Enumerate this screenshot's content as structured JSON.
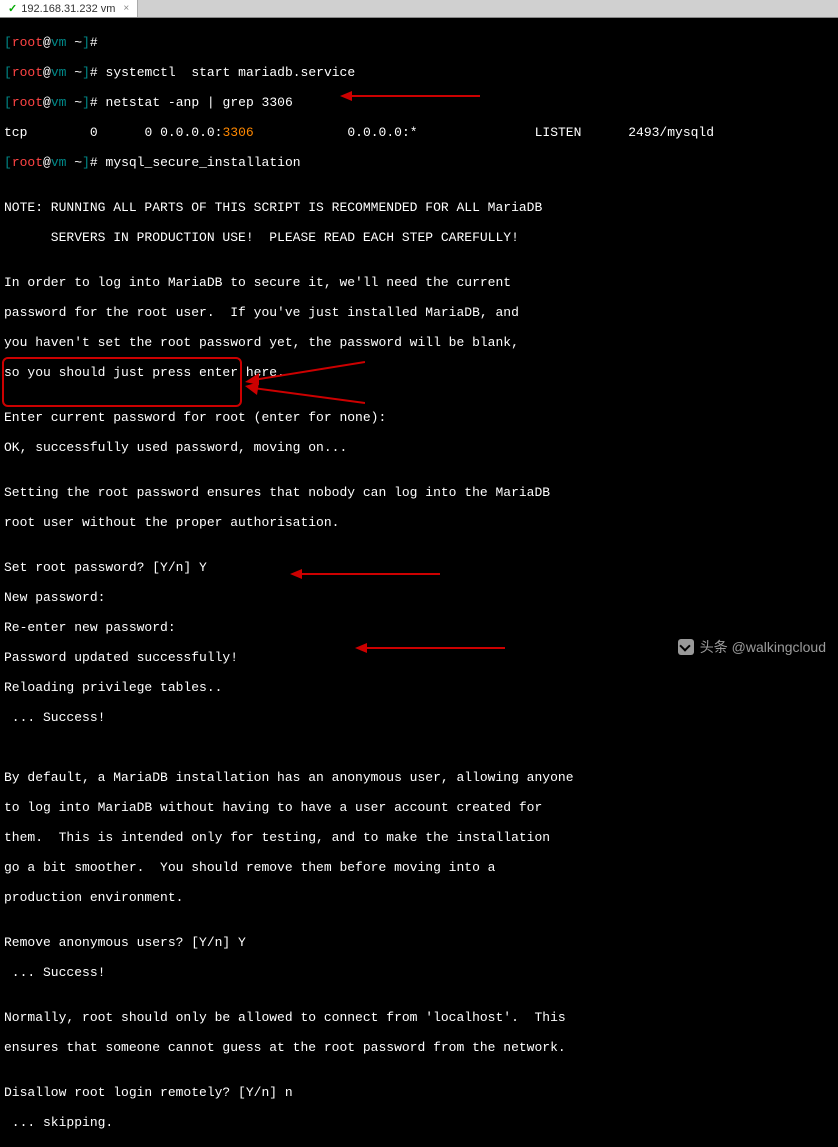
{
  "tab": {
    "title": "192.168.31.232 vm",
    "close": "×"
  },
  "prompts": {
    "user": "root",
    "host": "vm",
    "path": "~",
    "symbol": "#"
  },
  "commands": {
    "c0": "",
    "c1": "systemctl  start mariadb.service",
    "c2": "netstat -anp | grep 3306",
    "c3": "mysql_secure_installation"
  },
  "netstat": {
    "proto": "tcp",
    "recv": "0",
    "send": "0",
    "local_prefix": "0.0.0.0:",
    "port": "3306",
    "foreign": "0.0.0.0:*",
    "state": "LISTEN",
    "pid": "2493/mysqld"
  },
  "lines": {
    "l0": "",
    "note1": "NOTE: RUNNING ALL PARTS OF THIS SCRIPT IS RECOMMENDED FOR ALL MariaDB",
    "note2": "      SERVERS IN PRODUCTION USE!  PLEASE READ EACH STEP CAREFULLY!",
    "p1a": "In order to log into MariaDB to secure it, we'll need the current",
    "p1b": "password for the root user.  If you've just installed MariaDB, and",
    "p1c": "you haven't set the root password yet, the password will be blank,",
    "p1d": "so you should just press enter here.",
    "enter": "Enter current password for root (enter for none):",
    "ok": "OK, successfully used password, moving on...",
    "p2a": "Setting the root password ensures that nobody can log into the MariaDB",
    "p2b": "root user without the proper authorisation.",
    "setroot": "Set root password? [Y/n] Y",
    "newpass": "New password:",
    "reenter": "Re-enter new password:",
    "passok": "Password updated successfully!",
    "reload": "Reloading privilege tables..",
    "success1": " ... Success!",
    "p3a": "By default, a MariaDB installation has an anonymous user, allowing anyone",
    "p3b": "to log into MariaDB without having to have a user account created for",
    "p3c": "them.  This is intended only for testing, and to make the installation",
    "p3d": "go a bit smoother.  You should remove them before moving into a",
    "p3e": "production environment.",
    "removeanon": "Remove anonymous users? [Y/n] Y",
    "success2": " ... Success!",
    "p4a": "Normally, root should only be allowed to connect from 'localhost'.  This",
    "p4b": "ensures that someone cannot guess at the root password from the network.",
    "disallow": "Disallow root login remotely? [Y/n] n",
    "skipping": " ... skipping."
  },
  "watermark": "头条 @walkingcloud"
}
